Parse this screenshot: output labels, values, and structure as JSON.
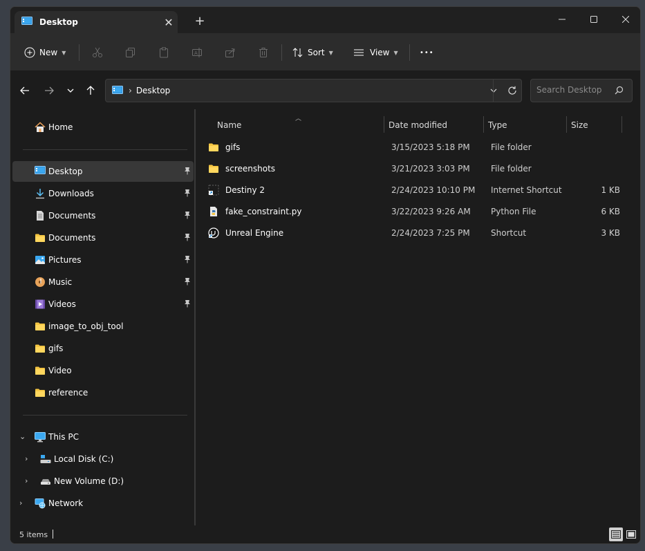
{
  "tab": {
    "title": "Desktop",
    "close": "✕",
    "new_tab": "+"
  },
  "window_controls": {
    "minimize": "—",
    "maximize": "☐",
    "close": "✕"
  },
  "commands": {
    "new_label": "New",
    "sort_label": "Sort",
    "view_label": "View",
    "more": "•••"
  },
  "address": {
    "crumbs": [
      "Desktop"
    ],
    "separator": "›",
    "search_placeholder": "Search Desktop"
  },
  "sidebar": {
    "home": "Home",
    "quick_access": [
      {
        "label": "Desktop",
        "icon": "desktop-icon",
        "pinned": true,
        "selected": true
      },
      {
        "label": "Downloads",
        "icon": "download-icon",
        "pinned": true
      },
      {
        "label": "Documents",
        "icon": "document-icon",
        "pinned": true
      },
      {
        "label": "Documents",
        "icon": "folder-icon",
        "pinned": true
      },
      {
        "label": "Pictures",
        "icon": "pictures-icon",
        "pinned": true
      },
      {
        "label": "Music",
        "icon": "music-icon",
        "pinned": true
      },
      {
        "label": "Videos",
        "icon": "videos-icon",
        "pinned": true
      },
      {
        "label": "image_to_obj_tool",
        "icon": "folder-icon"
      },
      {
        "label": "gifs",
        "icon": "folder-icon"
      },
      {
        "label": "Video",
        "icon": "folder-icon"
      },
      {
        "label": "reference",
        "icon": "folder-icon"
      }
    ],
    "this_pc": "This PC",
    "drives": [
      {
        "label": "Local Disk (C:)",
        "icon": "system-drive-icon"
      },
      {
        "label": "New Volume (D:)",
        "icon": "drive-icon"
      }
    ],
    "network": "Network",
    "pin_glyph": "📌"
  },
  "columns": [
    "Name",
    "Date modified",
    "Type",
    "Size"
  ],
  "files": [
    {
      "name": "gifs",
      "date": "3/15/2023 5:18 PM",
      "type": "File folder",
      "size": "",
      "icon": "folder-icon"
    },
    {
      "name": "screenshots",
      "date": "3/21/2023 3:03 PM",
      "type": "File folder",
      "size": "",
      "icon": "folder-icon"
    },
    {
      "name": "Destiny 2",
      "date": "2/24/2023 10:10 PM",
      "type": "Internet Shortcut",
      "size": "1 KB",
      "icon": "internet-shortcut-icon"
    },
    {
      "name": "fake_constraint.py",
      "date": "3/22/2023 9:26 AM",
      "type": "Python File",
      "size": "6 KB",
      "icon": "python-file-icon"
    },
    {
      "name": "Unreal Engine",
      "date": "2/24/2023 7:25 PM",
      "type": "Shortcut",
      "size": "3 KB",
      "icon": "unreal-engine-icon"
    }
  ],
  "status": {
    "count": "5 items"
  },
  "colors": {
    "folder": "#f4c542",
    "accent": "#4aa3df",
    "background": "#1c1c1c"
  }
}
